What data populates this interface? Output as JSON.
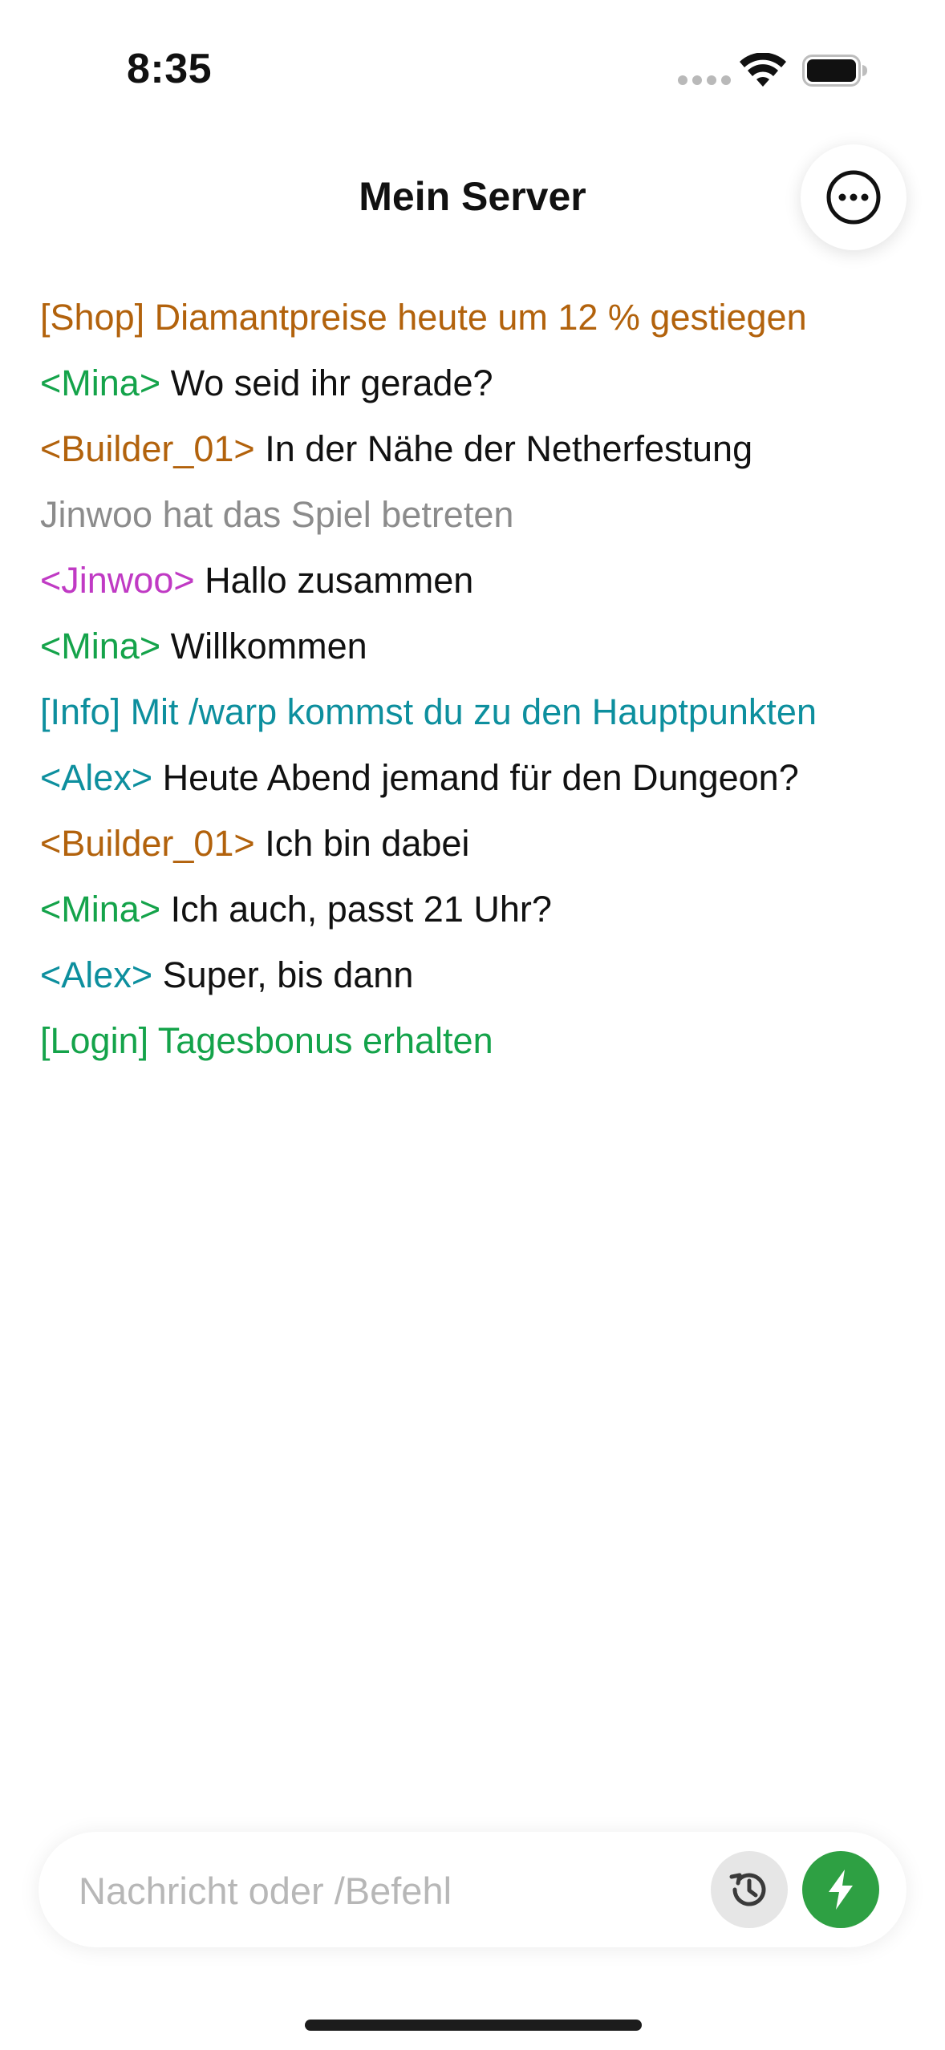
{
  "status_bar": {
    "time": "8:35"
  },
  "header": {
    "title": "Mein Server"
  },
  "colors": {
    "orange": "#b2620c",
    "green": "#14a34a",
    "gray": "#8c8c8c",
    "magenta": "#c03ac4",
    "teal": "#0d8f9e",
    "send_button": "#2ea043"
  },
  "chat": {
    "lines": [
      {
        "prefix": "[Shop] Diamantpreise heute um 12 % gestiegen",
        "text": ""
      },
      {
        "prefix": "<Mina>",
        "text": " Wo seid ihr gerade?"
      },
      {
        "prefix": "<Builder_01>",
        "text": " In der Nähe der Netherfestung"
      },
      {
        "prefix": "Jinwoo hat das Spiel betreten",
        "text": ""
      },
      {
        "prefix": "<Jinwoo>",
        "text": " Hallo zusammen"
      },
      {
        "prefix": "<Mina>",
        "text": " Willkommen"
      },
      {
        "prefix": "[Info] Mit /warp kommst du zu den Hauptpunkten",
        "text": ""
      },
      {
        "prefix": "<Alex>",
        "text": " Heute Abend jemand für den Dungeon?"
      },
      {
        "prefix": "<Builder_01>",
        "text": " Ich bin dabei"
      },
      {
        "prefix": "<Mina>",
        "text": " Ich auch, passt 21 Uhr?"
      },
      {
        "prefix": "<Alex>",
        "text": " Super, bis dann"
      },
      {
        "prefix": "[Login] Tagesbonus erhalten",
        "text": ""
      }
    ]
  },
  "input": {
    "placeholder": "Nachricht oder /Befehl",
    "value": ""
  },
  "icons": {
    "more": "ellipsis-circle-icon",
    "history": "history-icon",
    "send": "lightning-bolt-icon"
  }
}
